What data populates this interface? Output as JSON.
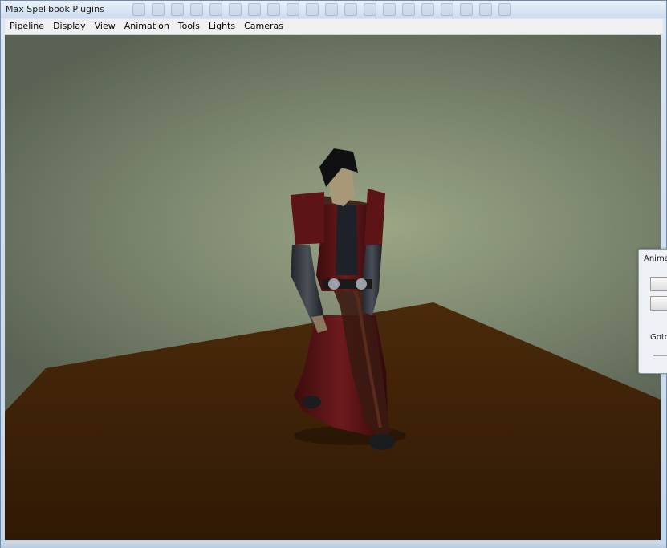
{
  "window": {
    "title": "Max Spellbook Plugins"
  },
  "menubar": {
    "items": [
      {
        "label": "Pipeline"
      },
      {
        "label": "Display"
      },
      {
        "label": "View"
      },
      {
        "label": "Animation"
      },
      {
        "label": "Tools"
      },
      {
        "label": "Lights"
      },
      {
        "label": "Cameras"
      }
    ]
  },
  "side_panel": {
    "title": "Anima",
    "goto_label": "Goto"
  },
  "scene": {
    "floor_color": "#3b2006",
    "background_color": "#8f9a7c"
  }
}
